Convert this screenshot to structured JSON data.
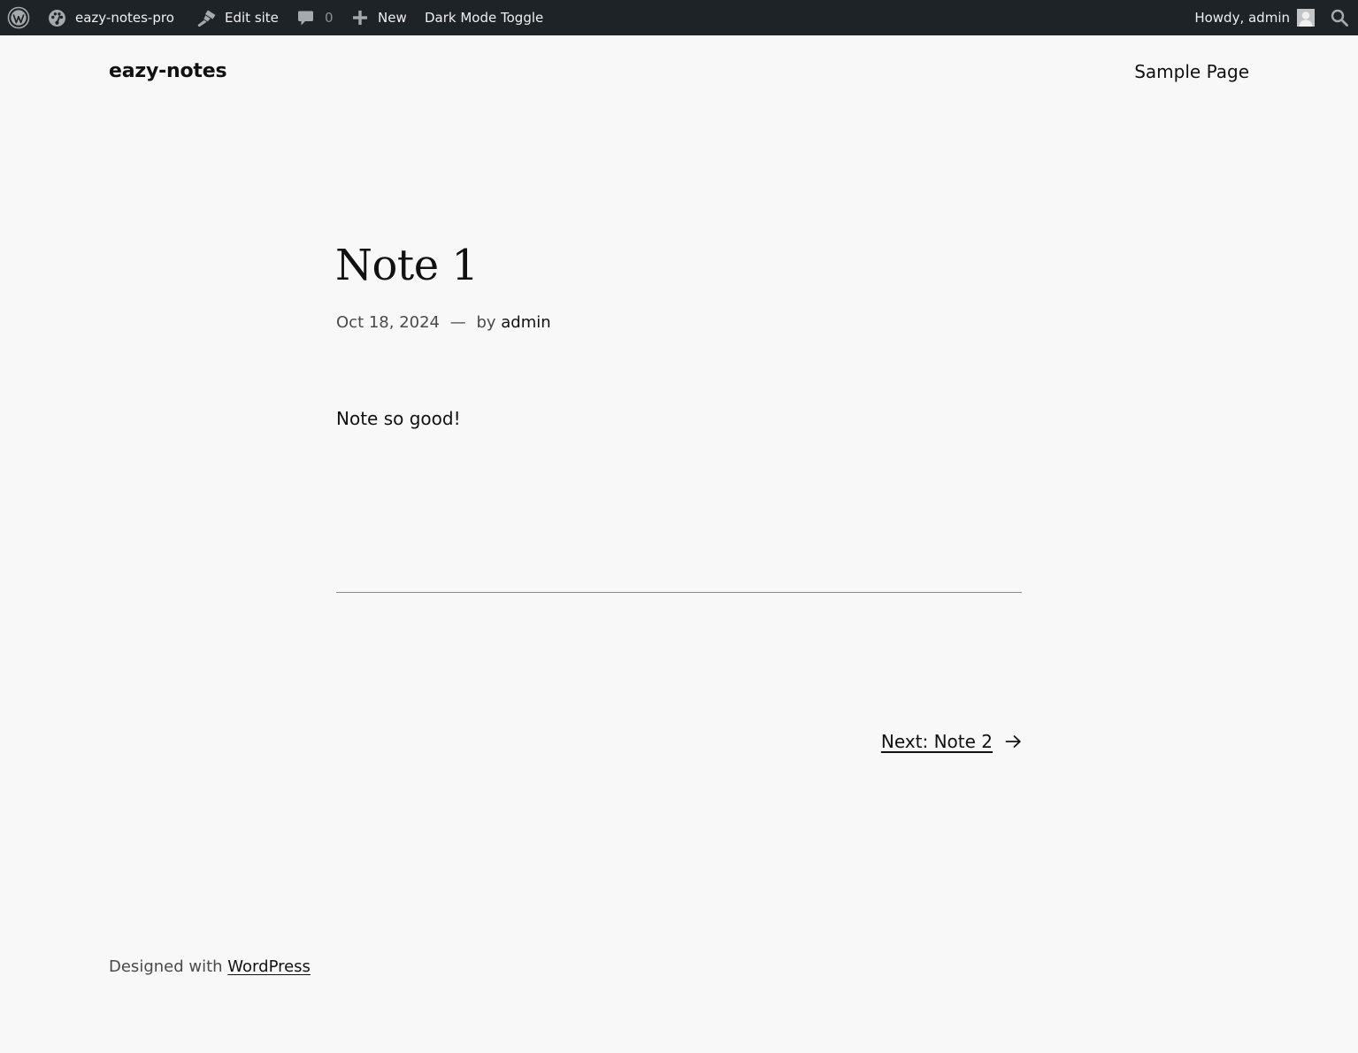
{
  "admin_bar": {
    "wp_logo_icon": "wordpress-logo-icon",
    "site_name": "eazy-notes-pro",
    "site_icon": "dashboard-icon",
    "edit_site": "Edit site",
    "edit_icon": "brush-icon",
    "comments_count": "0",
    "comments_icon": "comment-bubble-icon",
    "new": "New",
    "new_icon": "plus-icon",
    "dark_mode": "Dark Mode Toggle",
    "howdy": "Howdy, admin",
    "avatar_icon": "user-avatar-icon",
    "search_icon": "search-icon",
    "background_color": "#1d2327",
    "text_color": "#f0f0f1"
  },
  "header": {
    "site_title": "eazy-notes",
    "nav": [
      "Sample Page"
    ]
  },
  "post": {
    "title": "Note 1",
    "date": "Oct 18, 2024",
    "separator": "—",
    "by": "by",
    "author": "admin",
    "content": "Note so good!"
  },
  "navigation": {
    "next_label": "Next: Note 2",
    "arrow_icon": "arrow-right-icon"
  },
  "footer": {
    "designed_with": "Designed with",
    "link": "WordPress"
  },
  "colors": {
    "page_background": "#f8f8f8",
    "text": "#111111",
    "muted_text": "#4a4a4a"
  }
}
